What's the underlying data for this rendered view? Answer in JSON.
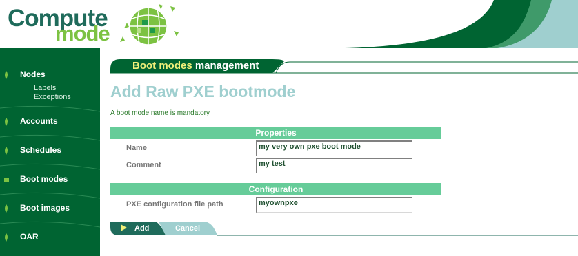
{
  "logo": {
    "word1": "Compute",
    "word2": "mode",
    "icon": "globe-icon"
  },
  "sidebar": {
    "items": [
      {
        "label": "Nodes",
        "icon": "leaf-bullet-icon",
        "subitems": [
          "Labels",
          "Exceptions"
        ]
      },
      {
        "label": "Accounts",
        "icon": "leaf-bullet-icon"
      },
      {
        "label": "Schedules",
        "icon": "leaf-bullet-icon"
      },
      {
        "label": "Boot modes",
        "icon": "leaf-bullet-icon"
      },
      {
        "label": "Boot images",
        "icon": "leaf-bullet-icon"
      },
      {
        "label": "OAR",
        "icon": "leaf-bullet-icon"
      }
    ]
  },
  "section": {
    "highlight": "Boot modes",
    "rest": " management"
  },
  "page": {
    "title": "Add Raw PXE bootmode",
    "error": "A boot mode name is mandatory"
  },
  "form": {
    "properties_header": "Properties",
    "name_label": "Name",
    "name_value": "my very own pxe boot mode",
    "comment_label": "Comment",
    "comment_value": "my test",
    "configuration_header": "Configuration",
    "pxe_label": "PXE configuration file path",
    "pxe_value": "myownpxe"
  },
  "buttons": {
    "add": "Add",
    "cancel": "Cancel"
  },
  "colors": {
    "dark_green": "#006432",
    "teal_green": "#1f6b5b",
    "light_green": "#7cc242",
    "band_green": "#66cc99",
    "light_teal": "#9fcfcf",
    "accent_yellow": "#f0f07a"
  }
}
